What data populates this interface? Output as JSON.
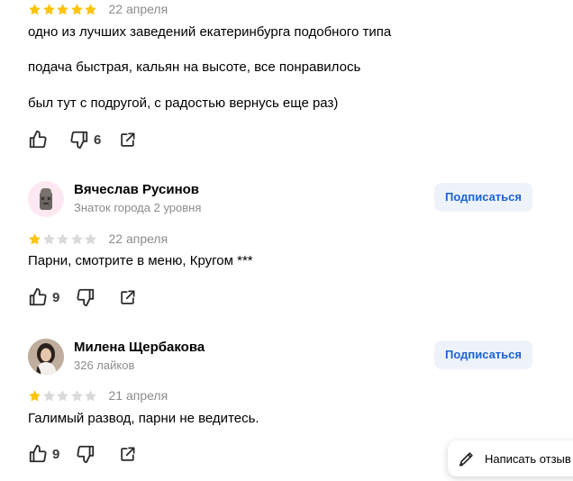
{
  "reviews": [
    {
      "rating": 5,
      "date": "22 апреля",
      "paragraphs": [
        "одно из лучших заведений екатеринбурга подобного типа",
        "подача быстрая, кальян на высоте, все понравилось",
        "был тут с подругой, с радостью вернусь еще раз)"
      ],
      "likes": "",
      "dislikes": "6"
    },
    {
      "author": "Вячеслав Русинов",
      "author_sub": "Знаток города 2 уровня",
      "subscribe_label": "Подписаться",
      "rating": 1,
      "date": "22 апреля",
      "paragraphs": [
        "Парни, смотрите в меню, Кругом ***"
      ],
      "likes": "9",
      "dislikes": ""
    },
    {
      "author": "Милена Щербакова",
      "author_sub": "326 лайков",
      "subscribe_label": "Подписаться",
      "rating": 1,
      "date": "21 апреля",
      "paragraphs": [
        "Галимый развод, парни не ведитесь."
      ],
      "likes": "9",
      "dislikes": ""
    }
  ],
  "write_review_label": "Написать отзыв",
  "colors": {
    "star_filled": "#fcc30b",
    "star_empty": "#dadada",
    "accent": "#1a64d6",
    "subscribe_bg": "#eef3fb"
  },
  "icons": [
    "thumb-up-icon",
    "thumb-down-icon",
    "share-icon",
    "pencil-icon"
  ]
}
